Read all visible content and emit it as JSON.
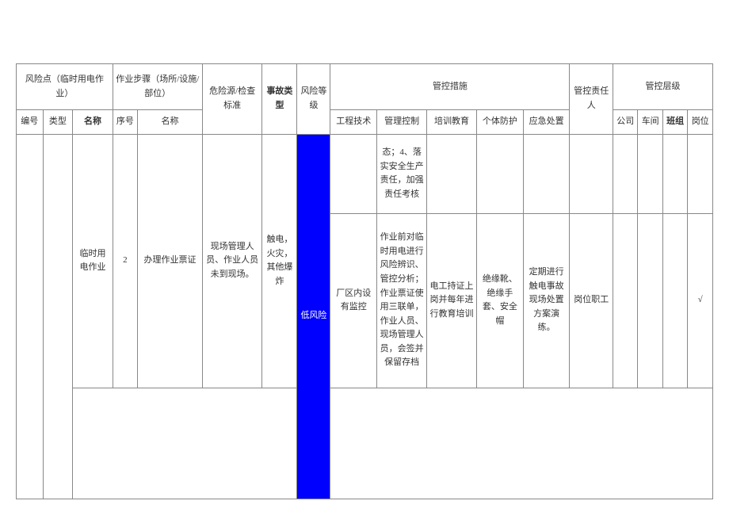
{
  "header": {
    "risk_point_group": "风险点（临时用电作业）",
    "step_group": "作业步骤（场所/设施/部位）",
    "hazard_std": "危险源/检查标准",
    "accident_type": "事故类型",
    "risk_level": "风险等级",
    "measures_group": "管控措施",
    "responsible": "管控责任人",
    "level_group": "管控层级",
    "sub": {
      "num": "编号",
      "type": "类型",
      "name": "名称",
      "seq": "序号",
      "step_name": "名称",
      "eng": "工程技术",
      "mgmt": "管理控制",
      "train": "培训教育",
      "ppe": "个体防护",
      "emerg": "应急处置",
      "co": "公司",
      "ws": "车间",
      "team": "班组",
      "post": "岗位"
    }
  },
  "rows": [
    {
      "mgmt": "态；4、落实安全生产责任，加强责任考核"
    },
    {
      "name": "临时用电作业",
      "seq": "2",
      "step_name": "办理作业票证",
      "hazard": "现场管理人员、作业人员未到现场。",
      "accident": "触电，火灾，其他爆炸",
      "risk_level": "低风险",
      "eng": "厂区内设有监控",
      "mgmt": "作业前对临时用电进行风险辨识、管控分析；作业票证使用三联单，作业人员、现场管理人员，会签并保留存档",
      "train": "电工持证上岗并每年进行教育培训",
      "ppe": "绝缘靴、绝缘手套、安全帽",
      "emerg": "定期进行触电事故现场处置方案演练。",
      "responsible": "岗位职工",
      "post": "√"
    }
  ]
}
